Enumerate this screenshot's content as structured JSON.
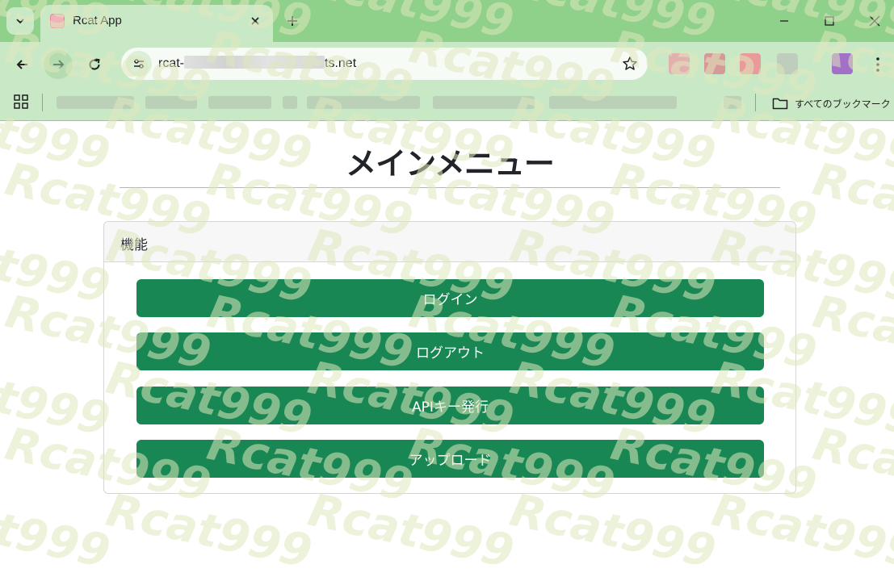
{
  "browser": {
    "tab_title": "Rcat App",
    "url_prefix": "rcat-",
    "url_suffix": "ts.net",
    "all_bookmarks_label": "すべてのブックマーク"
  },
  "watermark": {
    "text": "Rcat999"
  },
  "page": {
    "title": "メインメニュー",
    "card_header": "機能",
    "buttons": [
      {
        "label": "ログイン"
      },
      {
        "label": "ログアウト"
      },
      {
        "label": "APIキー発行"
      },
      {
        "label": "アップロード"
      }
    ]
  },
  "colors": {
    "tab_strip": "#8fd08a",
    "toolbar": "#c9e8c6",
    "button": "#198754",
    "watermark": "#dee8be"
  }
}
